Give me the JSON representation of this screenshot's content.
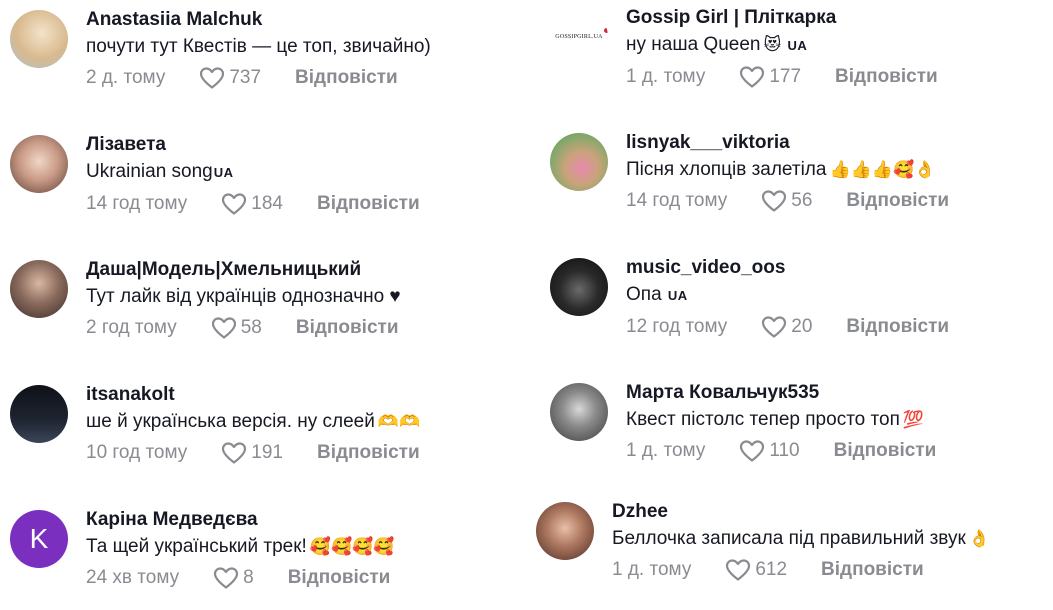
{
  "comments_left": [
    {
      "name": "Anastasiia Malchuk",
      "text": "почути тут Квестів — це топ, звичайно)",
      "time": "2 д. тому",
      "likes": "737",
      "reply": "Відповісти",
      "avatar_color": "#e8d4b8"
    },
    {
      "name": "Лізавета",
      "text": "Ukrainian song",
      "flag": "UA",
      "time": "14 год тому",
      "likes": "184",
      "reply": "Відповісти",
      "avatar_color": "#c89a85"
    },
    {
      "name": "Даша|Модель|Хмельницький",
      "text": "Тут лайк від українців однозначно ♥",
      "time": "2 год тому",
      "likes": "58",
      "reply": "Відповісти",
      "avatar_color": "#6b5a52"
    },
    {
      "name": "itsanakolt",
      "text": "ше й українська версія. ну слеей",
      "emoji": "🫶🫶",
      "time": "10 год тому",
      "likes": "191",
      "reply": "Відповісти",
      "avatar_color": "#1e2430"
    },
    {
      "name": "Каріна Медведєва",
      "text": "Та щей український трек!",
      "emoji": "🥰🥰🥰🥰",
      "time": "24 хв тому",
      "likes": "8",
      "reply": "Відповісти",
      "avatar_color": "#7b2fbf",
      "avatar_letter": "K"
    }
  ],
  "comments_right": [
    {
      "name": "Gossip Girl | Пліткарка",
      "text": "ну наша Queen",
      "emoji": "😻",
      "flag": "UA",
      "time": "1 д. тому",
      "likes": "177",
      "reply": "Відповісти",
      "avatar_logo": "GOSSIPGIRL.UA"
    },
    {
      "name": "lisnyak___viktoria",
      "text": "Пісня хлопців залетіла",
      "emoji": "👍👍👍🥰👌",
      "time": "14 год тому",
      "likes": "56",
      "reply": "Відповісти",
      "avatar_color": "#7fa86a"
    },
    {
      "name": "music_video_oos",
      "text": "Опа",
      "flag": "UA",
      "time": "12 год тому",
      "likes": "20",
      "reply": "Відповісти",
      "avatar_color": "#151515"
    },
    {
      "name": "Марта Ковальчук535",
      "text": "Квест пістолс тепер просто топ",
      "emoji": "💯",
      "time": "1 д. тому",
      "likes": "110",
      "reply": "Відповісти",
      "avatar_color": "#4a4a4a"
    },
    {
      "name": "Dzhee",
      "text": "Беллочка записала під правильний звук",
      "emoji": "👌",
      "time": "1 д. тому",
      "likes": "612",
      "reply": "Відповісти",
      "avatar_color": "#8a5a4a"
    }
  ]
}
